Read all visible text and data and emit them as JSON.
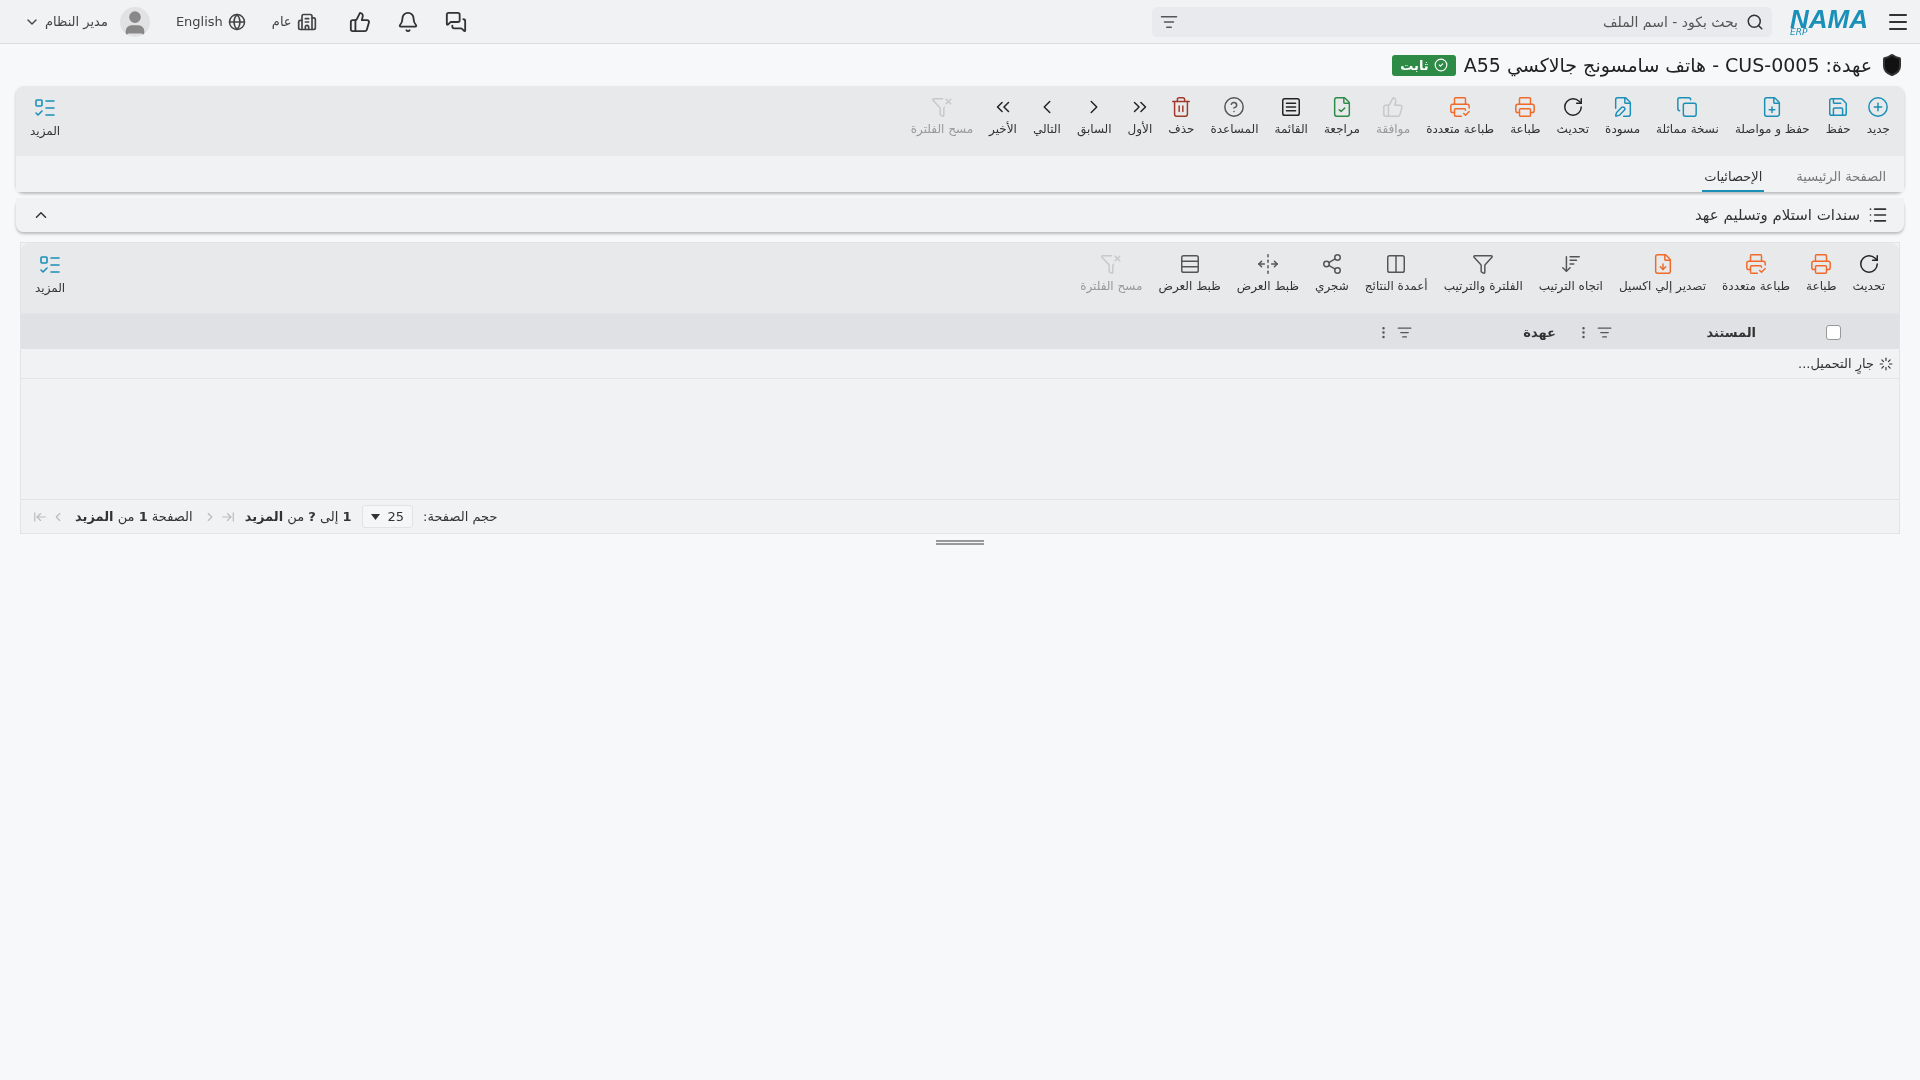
{
  "header": {
    "logo": "NAMA",
    "logo_sub": "ERP",
    "search": {
      "placeholder": "بحث بكود - اسم الملف"
    },
    "user": "مدير النظام",
    "language": "English",
    "branch": "عام"
  },
  "title": {
    "text": "عهدة: CUS-0005 - هاتف سامسونج جالاكسي A55",
    "badge": "ثابت"
  },
  "toolbar": {
    "buttons": [
      {
        "label": "جديد",
        "disabled": false
      },
      {
        "label": "حفظ",
        "disabled": false
      },
      {
        "label": "حفظ و مواصلة",
        "disabled": false
      },
      {
        "label": "نسخة مماثلة",
        "disabled": false
      },
      {
        "label": "مسودة",
        "disabled": false
      },
      {
        "label": "تحديث",
        "disabled": false
      },
      {
        "label": "طباعة",
        "disabled": false
      },
      {
        "label": "طباعة متعددة",
        "disabled": false
      },
      {
        "label": "موافقة",
        "disabled": true
      },
      {
        "label": "مراجعة",
        "disabled": false
      },
      {
        "label": "القائمة",
        "disabled": false
      },
      {
        "label": "المساعدة",
        "disabled": false
      },
      {
        "label": "حذف",
        "disabled": false
      },
      {
        "label": "الأول",
        "disabled": false
      },
      {
        "label": "السابق",
        "disabled": false
      },
      {
        "label": "التالي",
        "disabled": false
      },
      {
        "label": "الأخير",
        "disabled": false
      },
      {
        "label": "مسح الفلترة",
        "disabled": true
      }
    ],
    "more": "المزيد"
  },
  "tabs": [
    {
      "label": "الصفحة الرئيسية",
      "selected": false
    },
    {
      "label": "الإحصائيات",
      "selected": true
    }
  ],
  "section": {
    "title": "سندات استلام وتسليم عهد",
    "expanded": true,
    "toolbar": {
      "buttons": [
        {
          "label": "تحديث",
          "disabled": false
        },
        {
          "label": "طباعة",
          "disabled": false
        },
        {
          "label": "طباعة متعددة",
          "disabled": false
        },
        {
          "label": "تصدير إلي اكسيل",
          "disabled": false
        },
        {
          "label": "اتجاه الترتيب",
          "disabled": false
        },
        {
          "label": "الفلترة والترتيب",
          "disabled": false
        },
        {
          "label": "أعمدة النتائج",
          "disabled": false
        },
        {
          "label": "شجري",
          "disabled": false
        },
        {
          "label": "ظبط العرض",
          "disabled": false
        },
        {
          "label": "ظبط العرض",
          "disabled": false
        },
        {
          "label": "مسح الفلترة",
          "disabled": true
        }
      ],
      "more": "المزيد"
    },
    "table": {
      "select_all": {
        "checked": false
      },
      "columns": [
        "المستند",
        "عهدة"
      ],
      "loading": "جارٍ التحميل..."
    },
    "pager": {
      "page_size_label": "حجم الصفحة:",
      "page_size": "25",
      "range": "**1** إلى **?** من **المزيد**",
      "page": "الصفحة **1** من **المزيد**"
    }
  }
}
